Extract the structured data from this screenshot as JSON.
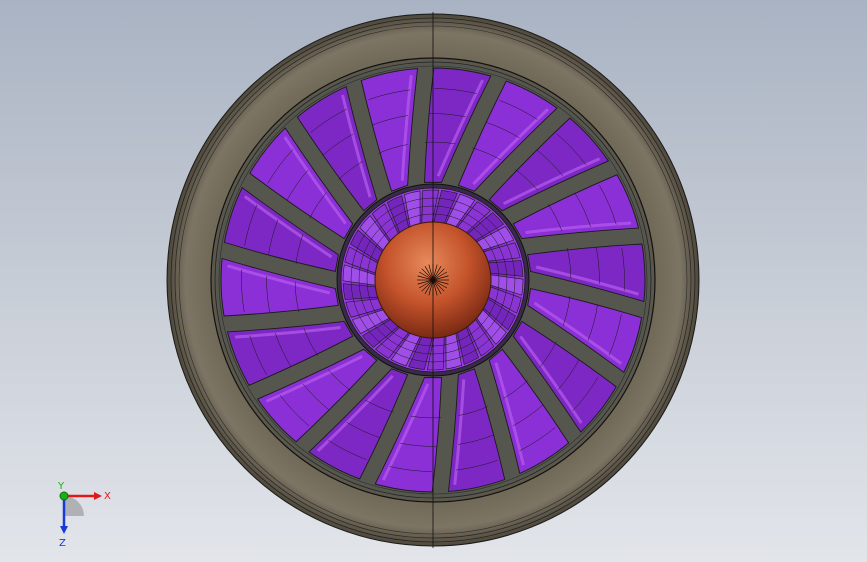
{
  "viewport": {
    "model": "turbofan-fan-assembly",
    "view": "front"
  },
  "colors": {
    "nacelle": "#6e6656",
    "nacelle_dark": "#3c362c",
    "nacelle_light": "#8a8270",
    "casing_inner": "#5e5a4e",
    "blade": "#8b2fd6",
    "blade_dark": "#5a1896",
    "blade_light": "#b65cf0",
    "gap": "#56584f",
    "spinner": "#c0502a",
    "spinner_light": "#e07848",
    "spinner_dark": "#7a2a14",
    "edge": "#1a1a1a",
    "axis_x": "#e01818",
    "axis_y": "#18b018",
    "axis_z": "#1838d8"
  },
  "fan": {
    "outer_blade_count": 18,
    "inner_blade_count": 30
  },
  "triad": {
    "x_label": "X",
    "y_label": "Y",
    "z_label": "Z"
  }
}
